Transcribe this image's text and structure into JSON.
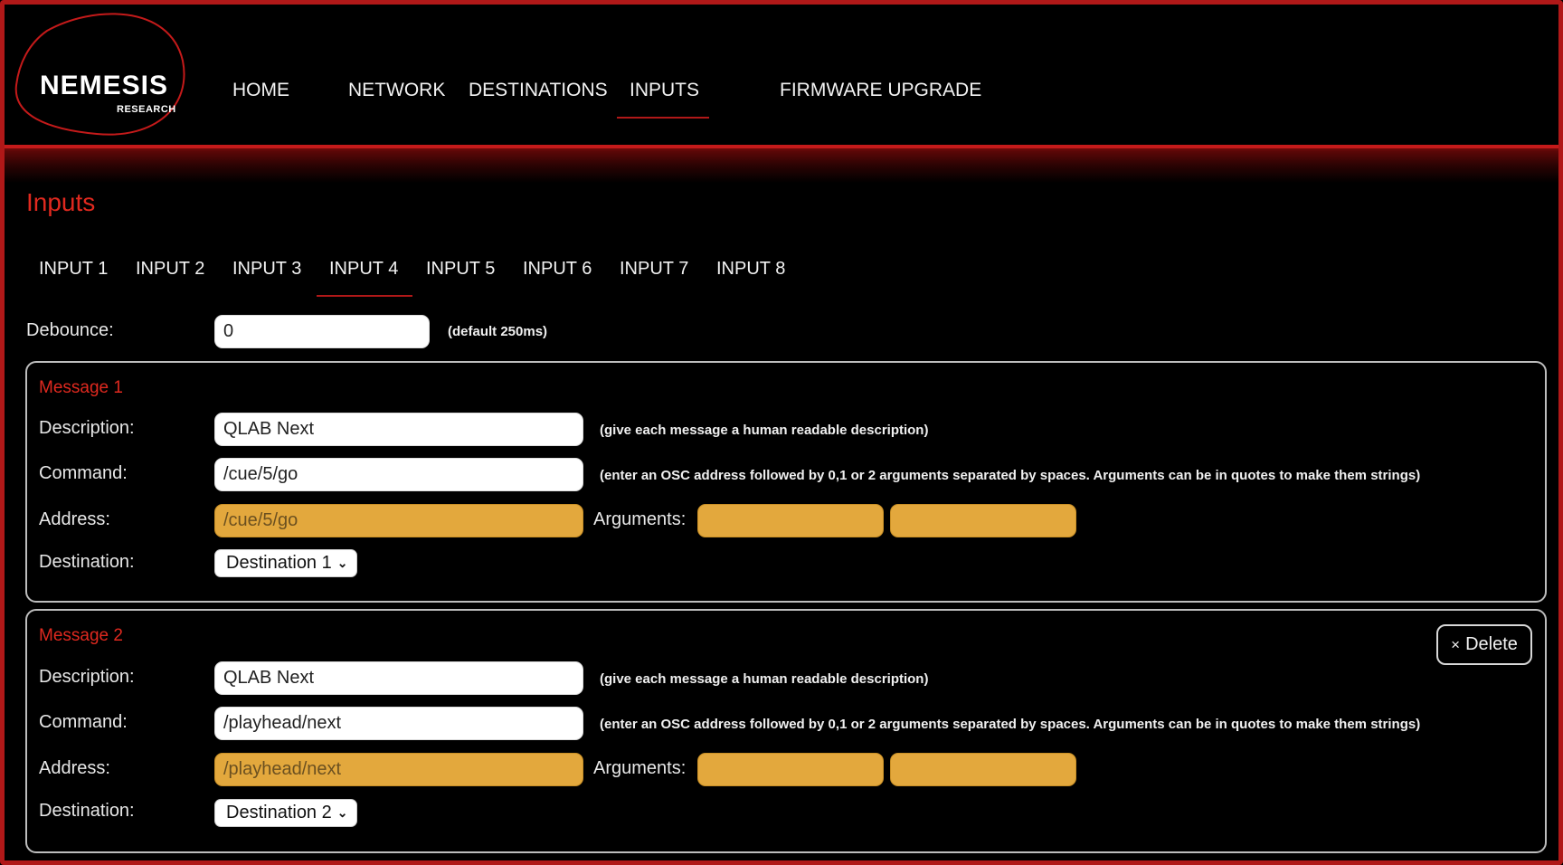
{
  "brand": {
    "name": "NEMESIS",
    "sub": "RESEARCH"
  },
  "nav": {
    "home": "HOME",
    "network": "NETWORK",
    "destinations": "DESTINATIONS",
    "inputs": "INPUTS",
    "firmware": "FIRMWARE UPGRADE",
    "active": "INPUTS"
  },
  "page": {
    "title": "Inputs"
  },
  "tabs": [
    "INPUT 1",
    "INPUT 2",
    "INPUT 3",
    "INPUT 4",
    "INPUT 5",
    "INPUT 6",
    "INPUT 7",
    "INPUT 8"
  ],
  "active_tab": "INPUT 4",
  "debounce": {
    "label": "Debounce:",
    "value": "0",
    "hint": "(default 250ms)"
  },
  "labels": {
    "description": "Description:",
    "command": "Command:",
    "address": "Address:",
    "arguments": "Arguments:",
    "destination": "Destination:"
  },
  "hints": {
    "description": "(give each message a human readable description)",
    "command": "(enter an OSC address followed by 0,1 or 2 arguments separated by spaces. Arguments can be in quotes to make them strings)"
  },
  "messages": [
    {
      "title": "Message 1",
      "description": "QLAB Next",
      "command": "/cue/5/go",
      "address": "/cue/5/go",
      "arg1": "",
      "arg2": "",
      "destination": "Destination 1"
    },
    {
      "title": "Message 2",
      "description": "QLAB Next",
      "command": "/playhead/next",
      "address": "/playhead/next",
      "arg1": "",
      "arg2": "",
      "destination": "Destination 2",
      "delete_label": "Delete"
    }
  ],
  "colors": {
    "accent_red": "#e0291f",
    "frame_red": "#b01818",
    "readonly_orange": "#e3a83d"
  }
}
